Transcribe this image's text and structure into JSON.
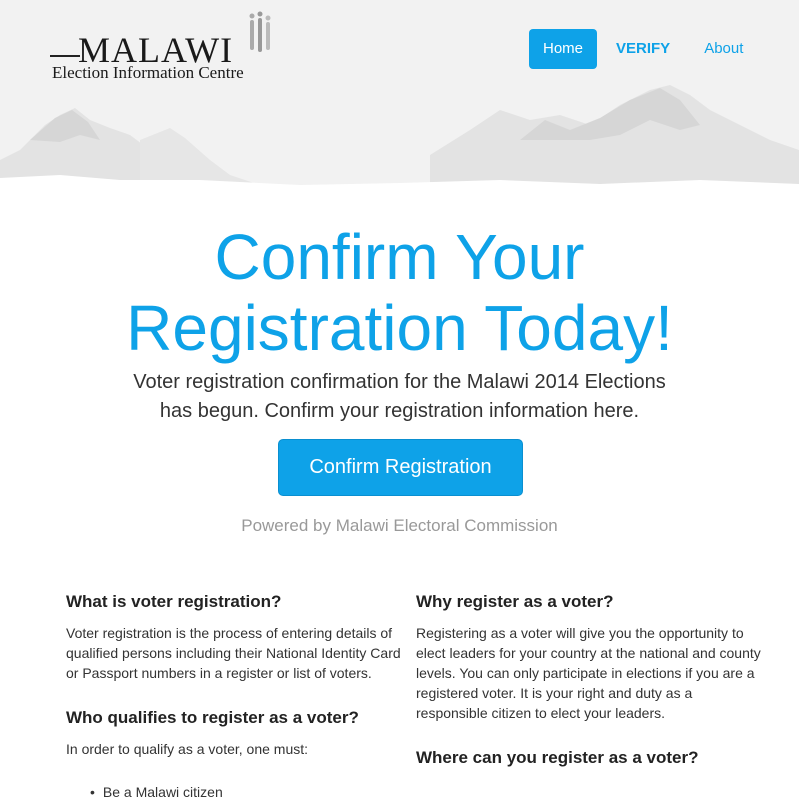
{
  "logo": {
    "title": "MALAWI",
    "subtitle": "Election Information Centre"
  },
  "nav": {
    "home": "Home",
    "verify": "VERIFY",
    "about": "About"
  },
  "hero": {
    "title_line1": "Confirm Your",
    "title_line2": "Registration Today!",
    "subtitle_line1": "Voter registration confirmation for the Malawi 2014 Elections",
    "subtitle_line2": "has begun. Confirm your registration information here.",
    "cta_label": "Confirm Registration",
    "powered_by": "Powered by Malawi Electoral Commission"
  },
  "left_column": {
    "what_heading": "What is voter registration?",
    "what_text": "Voter registration is the process of entering details of qualified persons including their National Identity Card or Passport numbers in a register or list of voters.",
    "who_heading": "Who qualifies to register as a voter?",
    "who_text": "In order to qualify as a voter, one must:",
    "who_items": [
      "Be a Malawi citizen"
    ]
  },
  "right_column": {
    "why_heading": "Why register as a voter?",
    "why_text": "Registering as a voter will give you the opportunity to elect leaders for your country at the national and county levels. You can only participate in elections if you are a registered voter. It is your right and duty as a responsible citizen to elect your leaders.",
    "where_heading": "Where can you register as a voter?"
  },
  "colors": {
    "accent": "#0ea2e8",
    "header_bg": "#f2f2f2",
    "muted": "#999999"
  }
}
